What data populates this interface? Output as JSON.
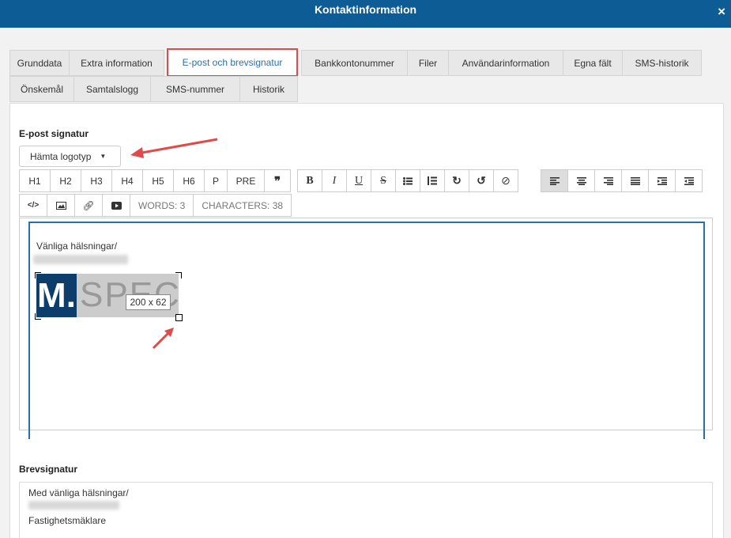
{
  "window": {
    "title": "Kontaktinformation",
    "close_icon": "×"
  },
  "tabs": {
    "row1": [
      "Grunddata",
      "Extra information",
      "E-post och brevsignatur",
      "Bankkontonummer",
      "Filer",
      "Användarinformation",
      "Egna fält",
      "SMS-historik"
    ],
    "row2": [
      "Önskemål",
      "Samtalslogg",
      "SMS-nummer",
      "Historik"
    ],
    "active": "E-post och brevsignatur"
  },
  "email_signature": {
    "heading": "E-post signatur",
    "logo_dropdown": "Hämta logotyp",
    "toolbar": {
      "headings": [
        "H1",
        "H2",
        "H3",
        "H4",
        "H5",
        "H6",
        "P",
        "PRE",
        "❞"
      ],
      "format": [
        "B",
        "I",
        "U",
        "S"
      ],
      "words": "WORDS: 3",
      "characters": "CHARACTERS: 38"
    },
    "content": {
      "greeting": "Vänliga hälsningar/",
      "logo_letter": "M.",
      "logo_text": "SPECS",
      "image_size": "200 x 62"
    }
  },
  "letter_signature": {
    "heading": "Brevsignatur",
    "greeting": "Med vänliga hälsningar/",
    "role": "Fastighetsmäklare"
  },
  "colors": {
    "titlebar": "#0d5c96",
    "highlight": "#e04a4a",
    "active_tab_text": "#2f6fa8"
  }
}
